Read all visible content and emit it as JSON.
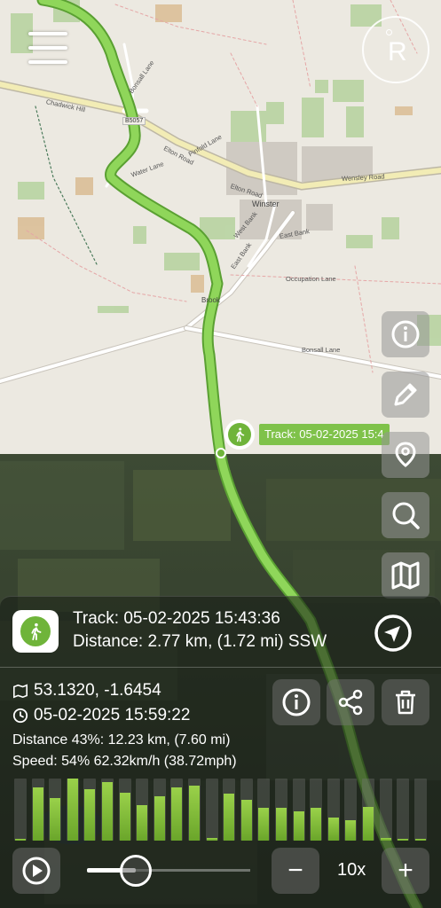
{
  "map": {
    "places": [
      {
        "name": "Winster"
      },
      {
        "name": "Brook"
      }
    ],
    "streets": [
      {
        "name": "Chadwick Hill"
      },
      {
        "name": "Bonsall Lane"
      },
      {
        "name": "Pinfold Lane"
      },
      {
        "name": "Water Lane"
      },
      {
        "name": "Elton Road"
      },
      {
        "name": "Elton Road"
      },
      {
        "name": "Wensley Road"
      },
      {
        "name": "West Bank"
      },
      {
        "name": "East Bank"
      },
      {
        "name": "East Bank"
      },
      {
        "name": "Occupation Lane"
      },
      {
        "name": "Bonsall Lane"
      }
    ],
    "road_ref": "B5057",
    "track_color": "#7fc24a"
  },
  "marker": {
    "label": "Track: 05-02-2025 15:4",
    "icon": "walking-person-icon"
  },
  "controls": {
    "menu_icon": "hamburger-menu-icon",
    "compass_letter": "R",
    "side_buttons": [
      {
        "icon": "info-icon"
      },
      {
        "icon": "pencil-icon"
      },
      {
        "icon": "location-pin-icon"
      },
      {
        "icon": "search-icon"
      },
      {
        "icon": "map-icon"
      }
    ]
  },
  "panel": {
    "track_title": "Track: 05-02-2025 15:43:36",
    "distance_line": "Distance: 2.77 km, (1.72 mi) SSW",
    "coords": "53.1320, -1.6454",
    "time": "05-02-2025 15:59:22",
    "distance_progress": "Distance 43%: 12.23 km, (7.60 mi)",
    "speed_progress": "Speed: 54% 62.32km/h (38.72mph)",
    "speed_multiplier": "10x",
    "minus_label": "−",
    "plus_label": "+",
    "accent_color": "#6fb43a",
    "playback_progress": 0.3
  },
  "chart_data": {
    "type": "bar",
    "values": [
      2,
      60,
      48,
      70,
      58,
      66,
      54,
      40,
      50,
      60,
      62,
      3,
      53,
      46,
      37,
      37,
      33,
      37,
      26,
      23,
      38,
      3,
      2,
      2
    ],
    "ylim": [
      0,
      70
    ]
  }
}
